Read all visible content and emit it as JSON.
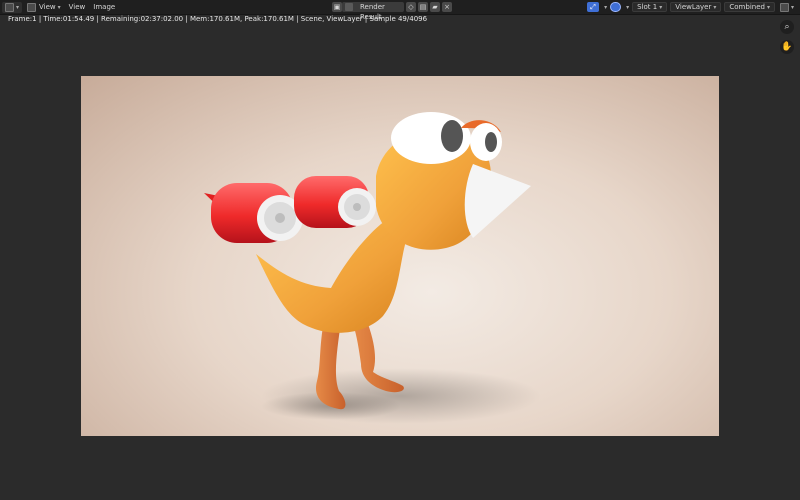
{
  "toolbar": {
    "menu": [
      "View",
      "View",
      "Image"
    ],
    "image_name": "Render Result",
    "slot": "Slot 1",
    "view_layer": "ViewLayer",
    "pass": "Combined"
  },
  "status": {
    "text": "Frame:1 | Time:01:54.49 | Remaining:02:37:02.00 | Mem:170.61M, Peak:170.61M | Scene, ViewLayer | Sample 49/4096"
  },
  "icons": {
    "editor": "image-editor-icon",
    "zoom": "zoom-icon",
    "pan": "hand-icon"
  },
  "colors": {
    "accent": "#3f6fd6",
    "background": "#2b2b2b",
    "topbar": "#1f1f1f"
  }
}
